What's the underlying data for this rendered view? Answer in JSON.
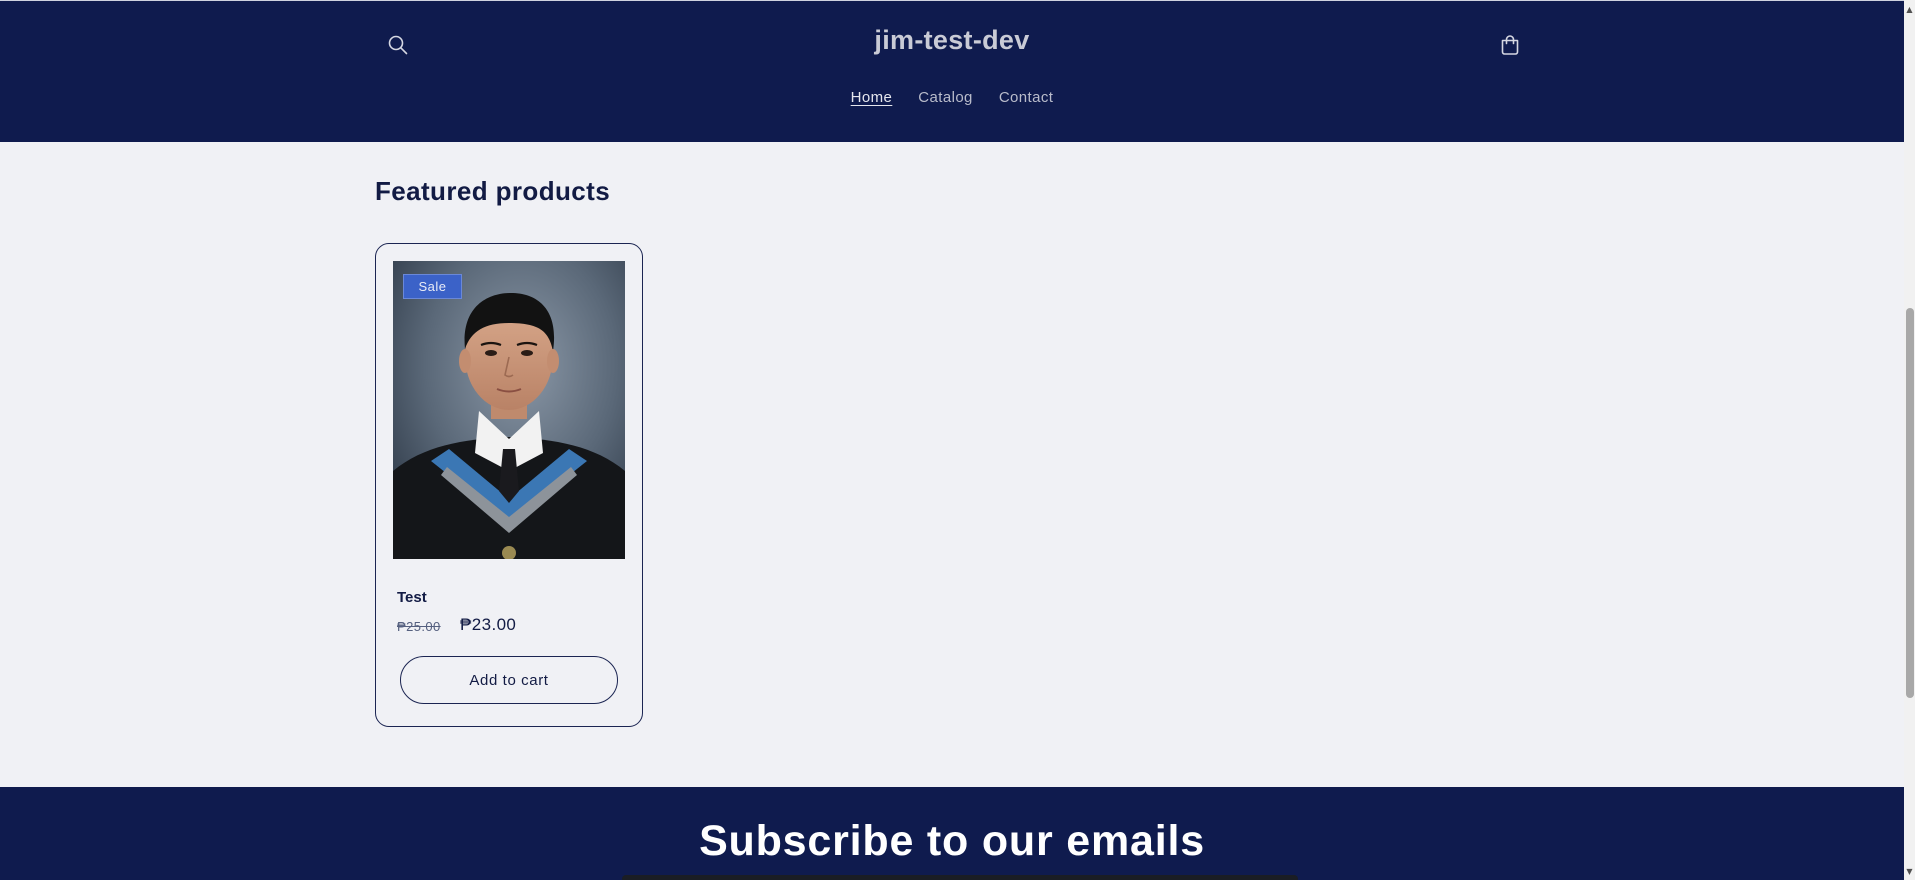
{
  "header": {
    "site_title": "jim-test-dev",
    "search_icon": "search-icon",
    "cart_icon": "cart-icon",
    "nav": [
      {
        "label": "Home",
        "active": true
      },
      {
        "label": "Catalog",
        "active": false
      },
      {
        "label": "Contact",
        "active": false
      }
    ]
  },
  "featured": {
    "title": "Featured products",
    "products": [
      {
        "badge": "Sale",
        "name": "Test",
        "price_original": "₱25.00",
        "price_sale": "₱23.00",
        "add_to_cart_label": "Add to cart"
      }
    ]
  },
  "subscribe": {
    "title": "Subscribe to our emails"
  },
  "colors": {
    "header_bg": "#0f1b4e",
    "page_bg": "#f0f1f5",
    "badge_bg": "#3b62c8",
    "text_dark": "#121b44"
  }
}
